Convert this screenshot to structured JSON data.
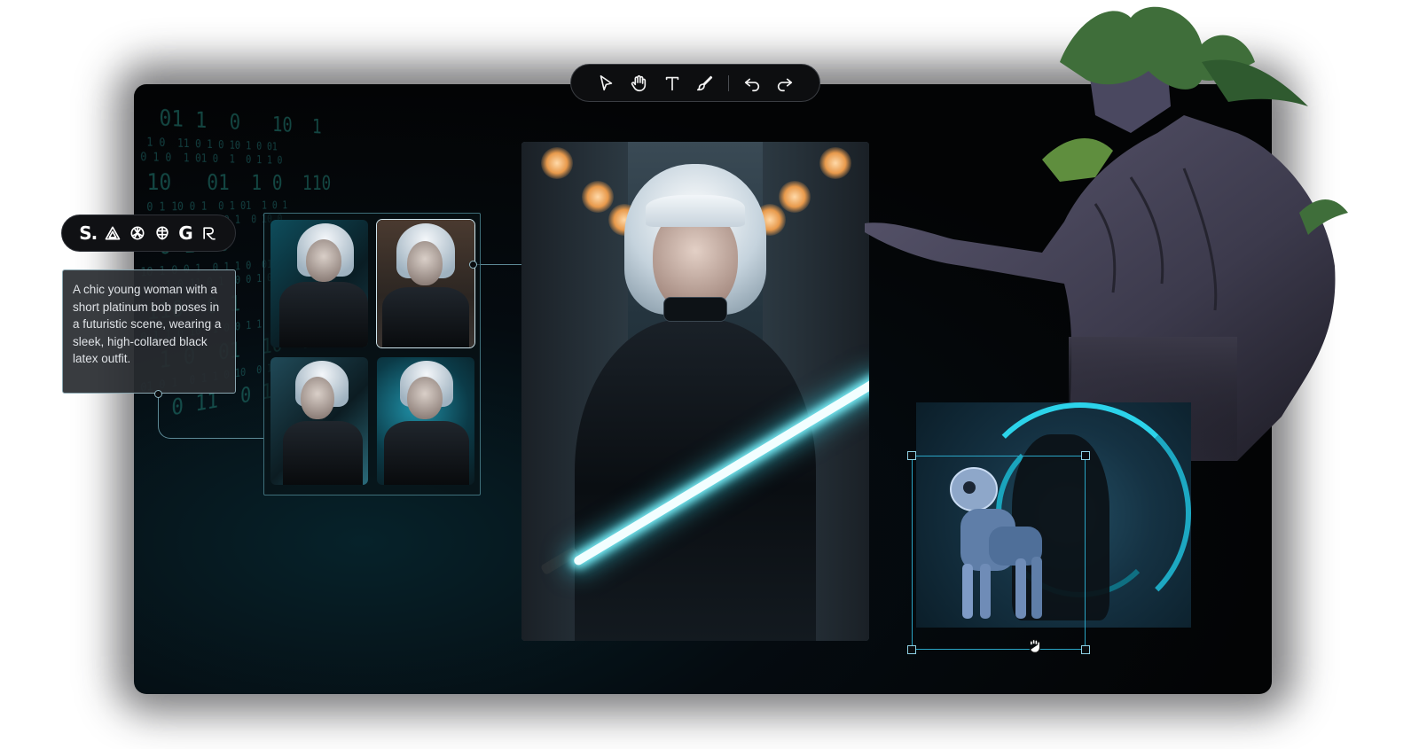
{
  "toolbar": {
    "tools": [
      {
        "name": "select",
        "icon": "cursor-arrow-icon"
      },
      {
        "name": "hand",
        "icon": "hand-icon"
      },
      {
        "name": "text",
        "icon": "text-icon"
      },
      {
        "name": "brush",
        "icon": "brush-icon"
      },
      {
        "name": "undo",
        "icon": "undo-icon"
      },
      {
        "name": "redo",
        "icon": "redo-icon"
      }
    ]
  },
  "models": {
    "items": [
      {
        "label": "S.",
        "icon": "stability-icon"
      },
      {
        "icon": "triangle-model-icon"
      },
      {
        "icon": "openai-icon"
      },
      {
        "icon": "brain-model-icon"
      },
      {
        "label": "G",
        "icon": "google-icon"
      },
      {
        "icon": "runway-icon"
      }
    ]
  },
  "prompt": {
    "text": "A chic young woman with a short platinum bob poses in a futuristic scene, wearing a sleek, high-collared black latex outfit."
  },
  "colors": {
    "accent": "#2aa4c4",
    "canvas_bg": "#030405",
    "saber_glow": "#7ff6ff"
  }
}
